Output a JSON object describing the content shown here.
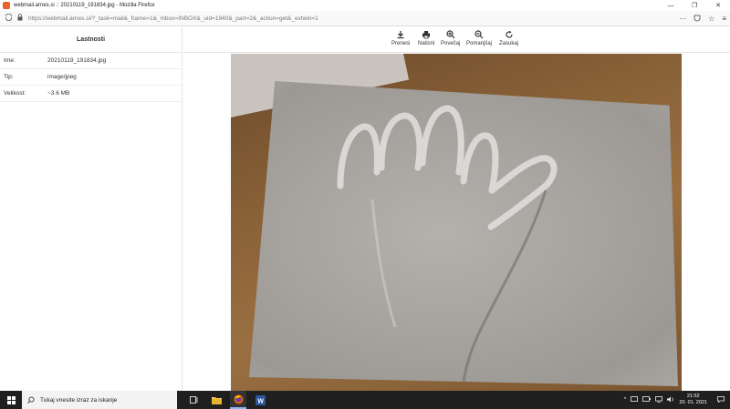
{
  "browser": {
    "window_title": "webmail.arnes.si :: 20210119_191834.jpg - Mozilla Firefox",
    "url_host": "https://webmail.arnes.si",
    "url_path": "/?_task=mail&_frame=1&_mbox=INBOX&_uid=1940&_part=2&_action=get&_extwin=1",
    "minimize": "—",
    "restore": "❐",
    "close": "✕"
  },
  "properties": {
    "header": "Lastnosti",
    "rows": [
      {
        "label": "Ime:",
        "value": "20210119_191834.jpg"
      },
      {
        "label": "Tip:",
        "value": "image/jpeg"
      },
      {
        "label": "Velikost:",
        "value": "~3.6 MB"
      }
    ]
  },
  "toolbar": {
    "download": "Prenesi",
    "print": "Natisni",
    "zoom_in": "Povečaj",
    "zoom_out": "Pomanjšaj",
    "rotate": "Zasukaj"
  },
  "taskbar": {
    "search_placeholder": "Tukaj vnesite izraz za iskanje",
    "time": "21:52",
    "date": "20. 01. 2021",
    "word_label": "W"
  },
  "colors": {
    "taskbar": "#1f1f1f",
    "accent": "#8ab4f8"
  }
}
